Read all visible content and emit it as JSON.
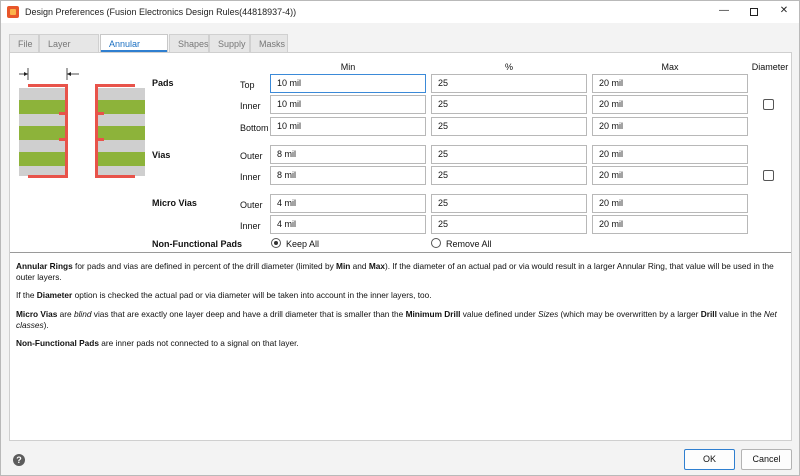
{
  "window": {
    "title": "Design Preferences (Fusion Electronics Design Rules(44818937-4))",
    "minimize": "—",
    "close": "✕"
  },
  "tabs": [
    "File",
    "Layer Stack",
    "Annular Ring",
    "Shapes",
    "Supply",
    "Masks"
  ],
  "active_tab": "Annular Ring",
  "columns": {
    "min": "Min",
    "percent": "%",
    "max": "Max",
    "diameter": "Diameter"
  },
  "pads": {
    "label": "Pads",
    "rows": [
      {
        "label": "Top",
        "min": "10 mil",
        "percent": "25",
        "max": "20 mil"
      },
      {
        "label": "Inner",
        "min": "10 mil",
        "percent": "25",
        "max": "20 mil"
      },
      {
        "label": "Bottom",
        "min": "10 mil",
        "percent": "25",
        "max": "20 mil"
      }
    ],
    "diameter_checked": false
  },
  "vias": {
    "label": "Vias",
    "rows": [
      {
        "label": "Outer",
        "min": "8 mil",
        "percent": "25",
        "max": "20 mil"
      },
      {
        "label": "Inner",
        "min": "8 mil",
        "percent": "25",
        "max": "20 mil"
      }
    ],
    "diameter_checked": false
  },
  "micro_vias": {
    "label": "Micro Vias",
    "rows": [
      {
        "label": "Outer",
        "min": "4 mil",
        "percent": "25",
        "max": "20 mil"
      },
      {
        "label": "Inner",
        "min": "4 mil",
        "percent": "25",
        "max": "20 mil"
      }
    ]
  },
  "non_functional": {
    "label": "Non-Functional Pads",
    "options": [
      "Keep All",
      "Remove All"
    ],
    "selected": "Keep All"
  },
  "help": {
    "p1": {
      "b1": "Annular Rings",
      "t1": " for pads and vias are defined in percent of the drill diameter (limited by ",
      "b2": "Min",
      "t2": " and ",
      "b3": "Max",
      "t3": "). If the diameter of an actual pad or via would result in a larger Annular Ring, that value will be used in the outer layers."
    },
    "p2": {
      "t1": "If the ",
      "b1": "Diameter",
      "t2": " option is checked the actual pad or via diameter will be taken into account in the inner layers, too."
    },
    "p3": {
      "b1": "Micro Vias",
      "t1": " are ",
      "i1": "blind",
      "t2": " vias that are exactly one layer deep and have a drill diameter that is smaller than the ",
      "b2": "Minimum Drill",
      "t3": " value defined under ",
      "i2": "Sizes",
      "t4": " (which may be overwritten by a larger ",
      "b3": "Drill",
      "t5": " value in the ",
      "i3": "Net classes",
      "t6": ")."
    },
    "p4": {
      "b1": "Non-Functional Pads",
      "t1": " are inner pads not connected to a signal on that layer."
    }
  },
  "footer": {
    "help_icon": "?",
    "ok": "OK",
    "cancel": "Cancel"
  },
  "colors": {
    "accent": "#2f7fd0",
    "copper": "#e8534a",
    "board": "#8db33a",
    "core": "#cfcfcf"
  }
}
